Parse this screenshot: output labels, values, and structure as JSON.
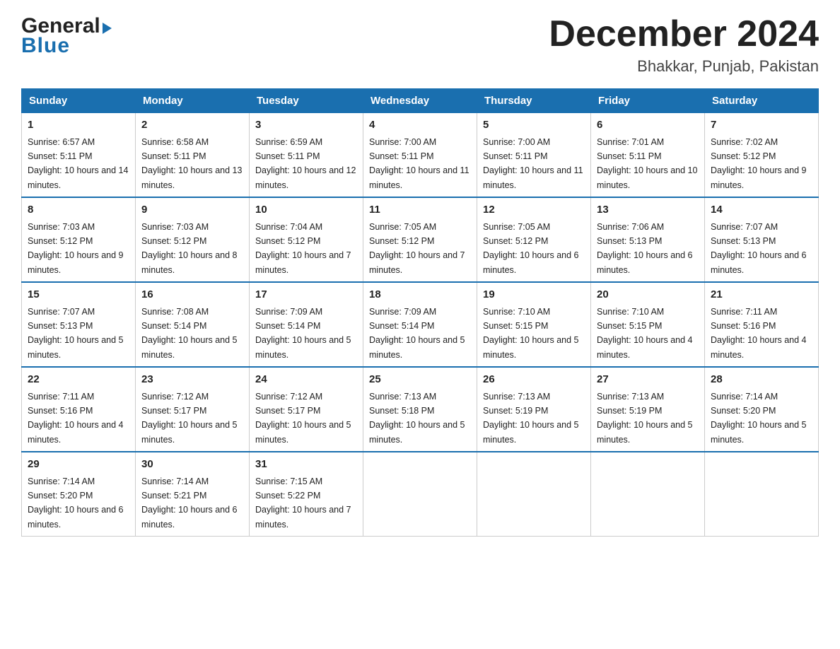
{
  "header": {
    "logo_general": "General",
    "logo_blue": "Blue",
    "month_title": "December 2024",
    "subtitle": "Bhakkar, Punjab, Pakistan"
  },
  "days_of_week": [
    "Sunday",
    "Monday",
    "Tuesday",
    "Wednesday",
    "Thursday",
    "Friday",
    "Saturday"
  ],
  "weeks": [
    [
      {
        "day": "1",
        "sunrise": "6:57 AM",
        "sunset": "5:11 PM",
        "daylight": "10 hours and 14 minutes."
      },
      {
        "day": "2",
        "sunrise": "6:58 AM",
        "sunset": "5:11 PM",
        "daylight": "10 hours and 13 minutes."
      },
      {
        "day": "3",
        "sunrise": "6:59 AM",
        "sunset": "5:11 PM",
        "daylight": "10 hours and 12 minutes."
      },
      {
        "day": "4",
        "sunrise": "7:00 AM",
        "sunset": "5:11 PM",
        "daylight": "10 hours and 11 minutes."
      },
      {
        "day": "5",
        "sunrise": "7:00 AM",
        "sunset": "5:11 PM",
        "daylight": "10 hours and 11 minutes."
      },
      {
        "day": "6",
        "sunrise": "7:01 AM",
        "sunset": "5:11 PM",
        "daylight": "10 hours and 10 minutes."
      },
      {
        "day": "7",
        "sunrise": "7:02 AM",
        "sunset": "5:12 PM",
        "daylight": "10 hours and 9 minutes."
      }
    ],
    [
      {
        "day": "8",
        "sunrise": "7:03 AM",
        "sunset": "5:12 PM",
        "daylight": "10 hours and 9 minutes."
      },
      {
        "day": "9",
        "sunrise": "7:03 AM",
        "sunset": "5:12 PM",
        "daylight": "10 hours and 8 minutes."
      },
      {
        "day": "10",
        "sunrise": "7:04 AM",
        "sunset": "5:12 PM",
        "daylight": "10 hours and 7 minutes."
      },
      {
        "day": "11",
        "sunrise": "7:05 AM",
        "sunset": "5:12 PM",
        "daylight": "10 hours and 7 minutes."
      },
      {
        "day": "12",
        "sunrise": "7:05 AM",
        "sunset": "5:12 PM",
        "daylight": "10 hours and 6 minutes."
      },
      {
        "day": "13",
        "sunrise": "7:06 AM",
        "sunset": "5:13 PM",
        "daylight": "10 hours and 6 minutes."
      },
      {
        "day": "14",
        "sunrise": "7:07 AM",
        "sunset": "5:13 PM",
        "daylight": "10 hours and 6 minutes."
      }
    ],
    [
      {
        "day": "15",
        "sunrise": "7:07 AM",
        "sunset": "5:13 PM",
        "daylight": "10 hours and 5 minutes."
      },
      {
        "day": "16",
        "sunrise": "7:08 AM",
        "sunset": "5:14 PM",
        "daylight": "10 hours and 5 minutes."
      },
      {
        "day": "17",
        "sunrise": "7:09 AM",
        "sunset": "5:14 PM",
        "daylight": "10 hours and 5 minutes."
      },
      {
        "day": "18",
        "sunrise": "7:09 AM",
        "sunset": "5:14 PM",
        "daylight": "10 hours and 5 minutes."
      },
      {
        "day": "19",
        "sunrise": "7:10 AM",
        "sunset": "5:15 PM",
        "daylight": "10 hours and 5 minutes."
      },
      {
        "day": "20",
        "sunrise": "7:10 AM",
        "sunset": "5:15 PM",
        "daylight": "10 hours and 4 minutes."
      },
      {
        "day": "21",
        "sunrise": "7:11 AM",
        "sunset": "5:16 PM",
        "daylight": "10 hours and 4 minutes."
      }
    ],
    [
      {
        "day": "22",
        "sunrise": "7:11 AM",
        "sunset": "5:16 PM",
        "daylight": "10 hours and 4 minutes."
      },
      {
        "day": "23",
        "sunrise": "7:12 AM",
        "sunset": "5:17 PM",
        "daylight": "10 hours and 5 minutes."
      },
      {
        "day": "24",
        "sunrise": "7:12 AM",
        "sunset": "5:17 PM",
        "daylight": "10 hours and 5 minutes."
      },
      {
        "day": "25",
        "sunrise": "7:13 AM",
        "sunset": "5:18 PM",
        "daylight": "10 hours and 5 minutes."
      },
      {
        "day": "26",
        "sunrise": "7:13 AM",
        "sunset": "5:19 PM",
        "daylight": "10 hours and 5 minutes."
      },
      {
        "day": "27",
        "sunrise": "7:13 AM",
        "sunset": "5:19 PM",
        "daylight": "10 hours and 5 minutes."
      },
      {
        "day": "28",
        "sunrise": "7:14 AM",
        "sunset": "5:20 PM",
        "daylight": "10 hours and 5 minutes."
      }
    ],
    [
      {
        "day": "29",
        "sunrise": "7:14 AM",
        "sunset": "5:20 PM",
        "daylight": "10 hours and 6 minutes."
      },
      {
        "day": "30",
        "sunrise": "7:14 AM",
        "sunset": "5:21 PM",
        "daylight": "10 hours and 6 minutes."
      },
      {
        "day": "31",
        "sunrise": "7:15 AM",
        "sunset": "5:22 PM",
        "daylight": "10 hours and 7 minutes."
      },
      null,
      null,
      null,
      null
    ]
  ],
  "labels": {
    "sunrise": "Sunrise:",
    "sunset": "Sunset:",
    "daylight": "Daylight:"
  }
}
